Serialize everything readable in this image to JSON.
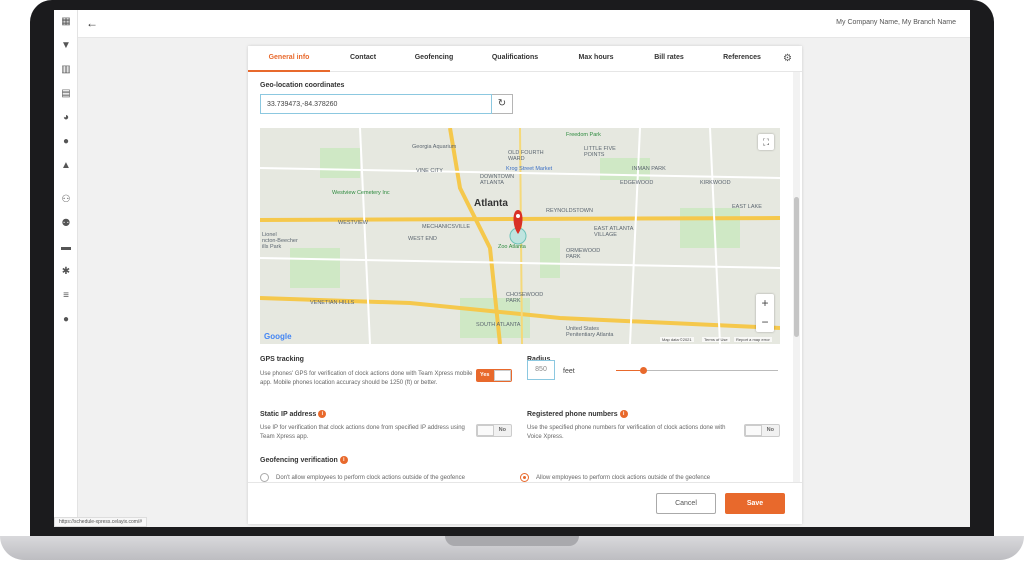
{
  "topbar": {
    "company": "My Company Name, My Branch Name"
  },
  "tabs": [
    "General info",
    "Contact",
    "Geofencing",
    "Qualifications",
    "Max hours",
    "Bill rates",
    "References"
  ],
  "geo": {
    "label": "Geo-location coordinates",
    "value": "33.739473,-84.378260"
  },
  "map": {
    "labels": {
      "atlanta": "Atlanta",
      "georgia_aquarium": "Georgia Aquarium",
      "freedom_park": "Freedom Park",
      "little_five": "LITTLE FIVE\nPOINTS",
      "old_fourth": "OLD FOURTH\nWARD",
      "vine_city": "VINE CITY",
      "krog": "Krog Street Market",
      "downtown": "DOWNTOWN\nATLANTA",
      "inman": "INMAN PARK",
      "edgewood": "EDGEWOOD",
      "kirkwood": "KIRKWOOD",
      "westview_cem": "Westview Cemetery Inc",
      "reynoldstown": "REYNOLDSTOWN",
      "mechanicsville": "MECHANICSVILLE",
      "westview": "WESTVIEW",
      "west_end": "WEST END",
      "zoo": "Zoo Atlanta",
      "east_atlanta": "EAST ATLANTA\nVILLAGE",
      "east_lake": "EAST LAKE",
      "lionel": "Lionel\nncton-Beecher\nills Park",
      "ormewood": "ORMEWOOD\nPARK",
      "venetian": "VENETIAN HILLS",
      "chosewood": "CHOSEWOOD\nPARK",
      "south_atlanta": "SOUTH ATLANTA",
      "penitentiary": "United States\nPenitentiary Atlanta"
    },
    "google": "Google",
    "map_data": "Map data ©2021",
    "terms": "Terms of Use",
    "report": "Report a map error"
  },
  "gps": {
    "label": "GPS tracking",
    "desc": "Use phones' GPS for verification of clock actions done with Team Xpress mobile app. Mobile phones location accuracy should be 1250 (ft) or better.",
    "toggle": "Yes"
  },
  "radius": {
    "label": "Radius",
    "value": "850",
    "unit": "feet",
    "slider_fraction": 0.15
  },
  "static_ip": {
    "label": "Static IP address",
    "desc": "Use IP for verification that clock actions done from specified IP address using Team Xpress app.",
    "toggle": "No"
  },
  "phones": {
    "label": "Registered phone numbers",
    "desc": "Use the specified phone numbers for verification of clock actions done with Voice Xpress.",
    "toggle": "No"
  },
  "geofence": {
    "label": "Geofencing verification",
    "opt1": "Don't allow employees to perform clock actions outside of the geofence",
    "opt2": "Allow employees to perform clock actions outside of the geofence"
  },
  "buttons": {
    "cancel": "Cancel",
    "save": "Save"
  },
  "statusbar": "https://schedule-xpress.celayix.com/#",
  "colors": {
    "accent": "#e8692c",
    "input_border": "#8cc8e0"
  }
}
